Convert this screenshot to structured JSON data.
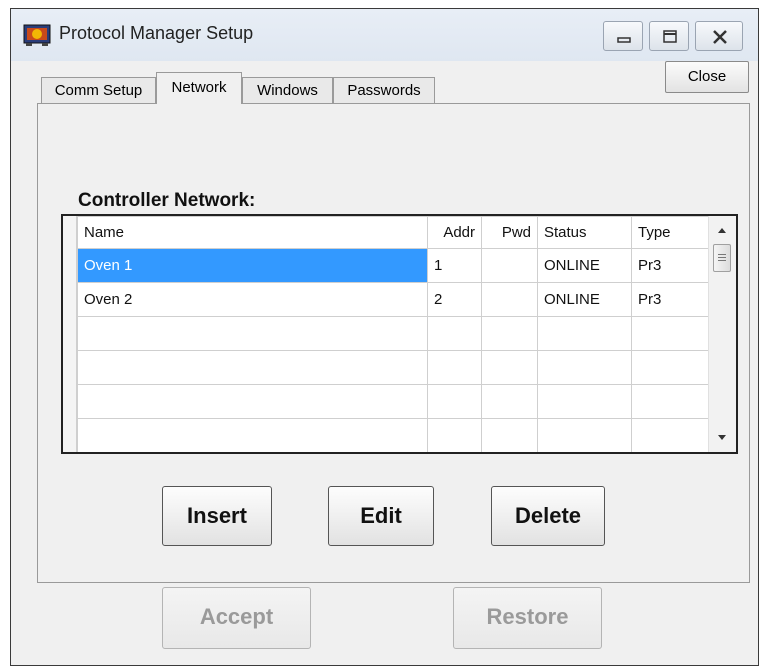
{
  "window": {
    "title": "Protocol Manager Setup"
  },
  "tabs": [
    {
      "label": "Comm Setup",
      "active": false
    },
    {
      "label": "Network",
      "active": true
    },
    {
      "label": "Windows",
      "active": false
    },
    {
      "label": "Passwords",
      "active": false
    }
  ],
  "close_label": "Close",
  "network": {
    "section_label": "Controller Network:",
    "columns": [
      "Name",
      "Addr",
      "Pwd",
      "Status",
      "Type"
    ],
    "rows": [
      {
        "name": "Oven 1",
        "addr": "1",
        "pwd": "",
        "status": "ONLINE",
        "type": "Pr3",
        "selected": true
      },
      {
        "name": "Oven 2",
        "addr": "2",
        "pwd": "",
        "status": "ONLINE",
        "type": "Pr3",
        "selected": false
      }
    ],
    "buttons": {
      "insert": "Insert",
      "edit": "Edit",
      "delete": "Delete"
    }
  },
  "footer": {
    "accept": "Accept",
    "restore": "Restore"
  },
  "icons": {
    "app": "protocol-manager-app-icon",
    "minimize": "minimize-icon",
    "maximize": "maximize-icon",
    "close": "close-icon",
    "scroll_up": "arrow-up-icon",
    "scroll_down": "arrow-down-icon"
  },
  "colors": {
    "selection": "#3399ff",
    "disabled_text": "#9a9a9a"
  }
}
